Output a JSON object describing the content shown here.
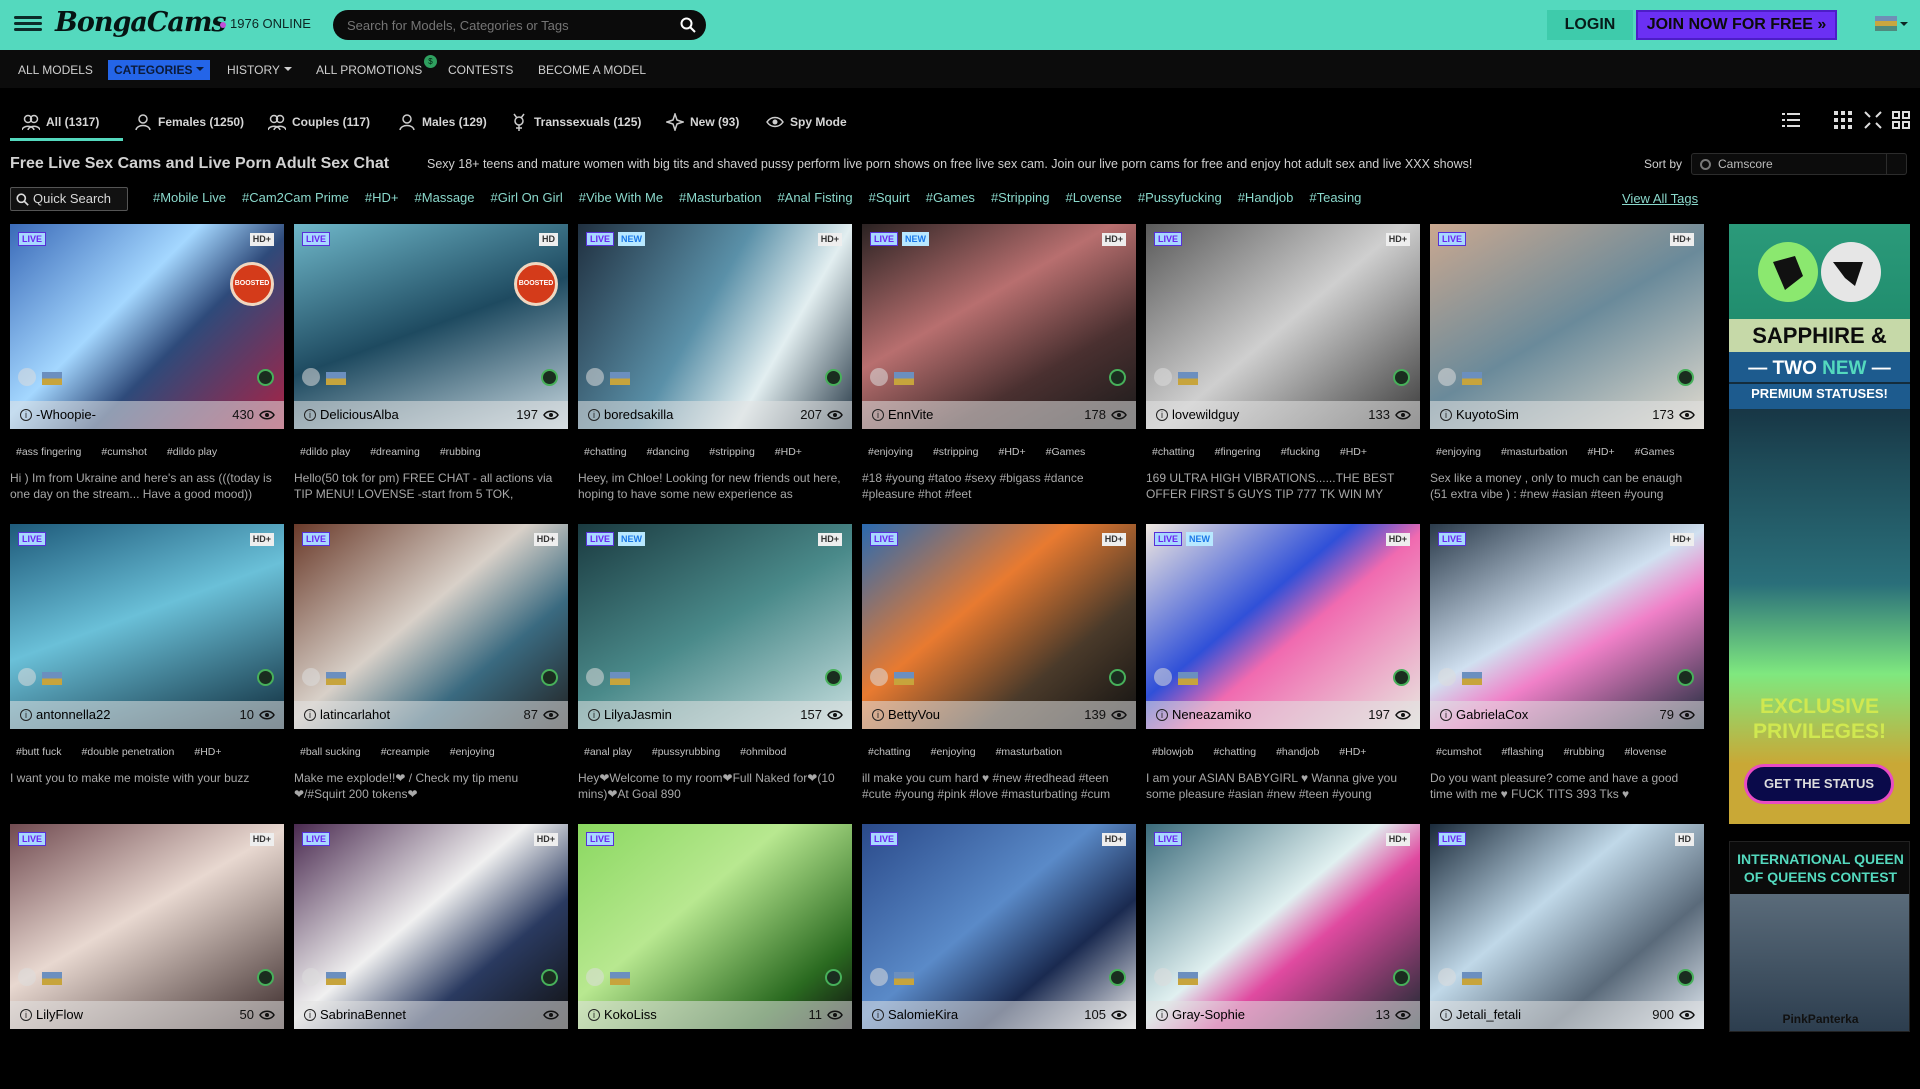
{
  "header": {
    "logo_text": "BongaCams",
    "online_count": "1976 ONLINE",
    "search_placeholder": "Search for Models, Categories or Tags",
    "login_label": "LOGIN",
    "join_label": "JOIN NOW FOR FREE »"
  },
  "nav": {
    "all_models": "ALL MODELS",
    "categories": "CATEGORIES",
    "history": "HISTORY",
    "all_promotions": "ALL PROMOTIONS",
    "promotions_badge": "$",
    "contests": "CONTESTS",
    "become_model": "BECOME A MODEL"
  },
  "tabs": [
    {
      "label": "All (1317)"
    },
    {
      "label": "Females (1250)"
    },
    {
      "label": "Couples (117)"
    },
    {
      "label": "Males (129)"
    },
    {
      "label": "Transsexuals (125)"
    },
    {
      "label": "New (93)"
    },
    {
      "label": "Spy Mode"
    }
  ],
  "page": {
    "title": "Free Live Sex Cams and Live Porn Adult Sex Chat",
    "description": "Sexy 18+ teens and mature women with big tits and shaved pussy perform live porn shows on free live sex cam. Join our live porn cams for free and enjoy hot adult sex and live XXX shows!",
    "sort_by_label": "Sort by",
    "sort_value": "Camscore",
    "quick_search": "Quick Search",
    "view_all_tags": "View All Tags"
  },
  "tags": [
    "#Mobile Live",
    "#Cam2Cam Prime",
    "#HD+",
    "#Massage",
    "#Girl On Girl",
    "#Vibe With Me",
    "#Masturbation",
    "#Anal Fisting",
    "#Squirt",
    "#Games",
    "#Stripping",
    "#Lovense",
    "#Pussyfucking",
    "#Handjob",
    "#Teasing"
  ],
  "labels": {
    "live": "LIVE",
    "new": "NEW",
    "boosted": "BOOSTED"
  },
  "models": [
    {
      "name": "-Whoopie-",
      "viewers": "430",
      "quality": "HD+",
      "tags": [
        "#ass fingering",
        "#cumshot",
        "#dildo play"
      ],
      "desc": "Hi ) Im from Ukraine and here's an ass (((today is one day on the stream... Have a good mood))",
      "boosted": true,
      "new": false
    },
    {
      "name": "DeliciousAlba",
      "viewers": "197",
      "quality": "HD",
      "tags": [
        "#dildo play",
        "#dreaming",
        "#rubbing"
      ],
      "desc": "Hello(50 tok for pm) FREE CHAT - all actions via TIP MENU! LOVENSE -start from 5 TOK,",
      "boosted": true,
      "new": false
    },
    {
      "name": "boredsakilla",
      "viewers": "207",
      "quality": "HD+",
      "tags": [
        "#chatting",
        "#dancing",
        "#stripping",
        "#HD+"
      ],
      "desc": "Heey, im Chloe! Looking for new friends out here, hoping to have some new experience as",
      "boosted": false,
      "new": true
    },
    {
      "name": "EnnVite",
      "viewers": "178",
      "quality": "HD+",
      "tags": [
        "#enjoying",
        "#stripping",
        "#HD+",
        "#Games"
      ],
      "desc": "#18 #young #tatoo #sexy #bigass #dance #pleasure #hot #feet",
      "boosted": false,
      "new": true
    },
    {
      "name": "lovewildguy",
      "viewers": "133",
      "quality": "HD+",
      "tags": [
        "#chatting",
        "#fingering",
        "#fucking",
        "#HD+"
      ],
      "desc": "169 ULTRA HIGH VIBRATIONS......THE BEST OFFER FIRST 5 GUYS TIP 777 TK WIN MY",
      "boosted": false,
      "new": false
    },
    {
      "name": "KuyotoSim",
      "viewers": "173",
      "quality": "HD+",
      "tags": [
        "#enjoying",
        "#masturbation",
        "#HD+",
        "#Games"
      ],
      "desc": "Sex like a money , only to much can be enaugh (51 extra vibe ) : #new #asian #teen #young",
      "boosted": false,
      "new": false
    },
    {
      "name": "antonnella22",
      "viewers": "10",
      "quality": "HD+",
      "tags": [
        "#butt fuck",
        "#double penetration",
        "#HD+"
      ],
      "desc": "I want you to make me moiste with your buzz",
      "boosted": false,
      "new": false
    },
    {
      "name": "latincarlahot",
      "viewers": "87",
      "quality": "HD+",
      "tags": [
        "#ball sucking",
        "#creampie",
        "#enjoying"
      ],
      "desc": "Make me explode!!❤ / Check my tip menu ❤/#Squirt 200 tokens❤",
      "boosted": false,
      "new": false
    },
    {
      "name": "LilyaJasmin",
      "viewers": "157",
      "quality": "HD+",
      "tags": [
        "#anal play",
        "#pussyrubbing",
        "#ohmibod"
      ],
      "desc": "Hey❤Welcome to my room❤Full Naked for❤(10 mins)❤At Goal 890",
      "boosted": false,
      "new": true
    },
    {
      "name": "BettyVou",
      "viewers": "139",
      "quality": "HD+",
      "tags": [
        "#chatting",
        "#enjoying",
        "#masturbation"
      ],
      "desc": "ill make you cum hard ♥ #new #redhead #teen #cute #young #pink #love #masturbating #cum",
      "boosted": false,
      "new": false
    },
    {
      "name": "Neneazamiko",
      "viewers": "197",
      "quality": "HD+",
      "tags": [
        "#blowjob",
        "#chatting",
        "#handjob",
        "#HD+"
      ],
      "desc": "I am your ASIAN BABYGIRL ♥ Wanna give you some pleasure #asian #new #teen #young",
      "boosted": false,
      "new": true
    },
    {
      "name": "GabrielaCox",
      "viewers": "79",
      "quality": "HD+",
      "tags": [
        "#cumshot",
        "#flashing",
        "#rubbing",
        "#lovense"
      ],
      "desc": "Do you want pleasure? come and have a good time with me ♥ FUCK TITS 393 Tks ♥",
      "boosted": false,
      "new": false
    },
    {
      "name": "LilyFlow",
      "viewers": "50",
      "quality": "HD+",
      "tags": [],
      "desc": "",
      "boosted": false,
      "new": false
    },
    {
      "name": "SabrinaBennet",
      "viewers": "",
      "quality": "HD+",
      "tags": [],
      "desc": "",
      "boosted": false,
      "new": false
    },
    {
      "name": "KokoLiss",
      "viewers": "11",
      "quality": "",
      "tags": [],
      "desc": "",
      "boosted": false,
      "new": false
    },
    {
      "name": "SalomieKira",
      "viewers": "105",
      "quality": "HD+",
      "tags": [],
      "desc": "",
      "boosted": false,
      "new": false
    },
    {
      "name": "Gray-Sophie",
      "viewers": "13",
      "quality": "HD+",
      "tags": [],
      "desc": "",
      "boosted": false,
      "new": false
    },
    {
      "name": "Jetali_fetali",
      "viewers": "900",
      "quality": "HD",
      "tags": [],
      "desc": "",
      "boosted": false,
      "new": false
    }
  ],
  "ads": {
    "ad1_brand": "SAPPHIRE & TITAN",
    "ad1_line1_a": "— TWO ",
    "ad1_line1_b": "NEW",
    "ad1_line1_c": " —",
    "ad1_line2": "PREMIUM STATUSES!",
    "ad1_line3": "EXCLUSIVE PRIVILEGES!",
    "ad1_button": "GET THE STATUS",
    "ad2_title": "INTERNATIONAL QUEEN OF QUEENS CONTEST",
    "ad2_name": "PinkPanterka"
  },
  "colors": {
    "accent": "#54d9be",
    "join_bg": "#6b30f4",
    "categories_bg": "#2465e8",
    "tag_text": "#8ad8cb"
  }
}
